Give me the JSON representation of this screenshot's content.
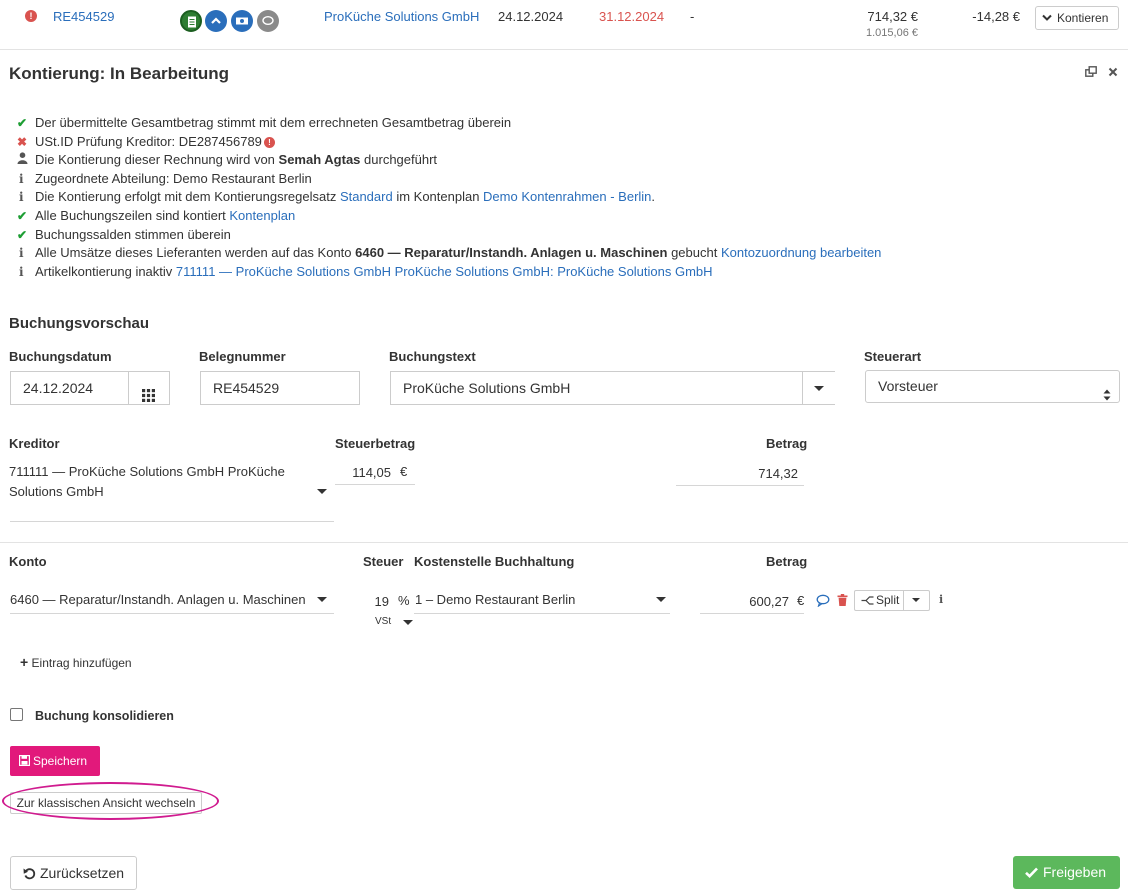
{
  "invoice_row": {
    "invoice_number": "RE454529",
    "vendor": "ProKüche Solutions GmbH",
    "invoice_date": "24.12.2024",
    "due_date": "31.12.2024",
    "dash": "-",
    "amount": "714,32 €",
    "amount_gross": "1.015,06 €",
    "difference": "-14,28 €",
    "action_label": "Kontieren"
  },
  "panel": {
    "title": "Kontierung: In Bearbeitung"
  },
  "checks": [
    {
      "status": "ok",
      "text": "Der übermittelte Gesamtbetrag stimmt mit dem errechneten Gesamtbetrag überein"
    },
    {
      "status": "error",
      "text": "USt.ID Prüfung Kreditor: DE287456789"
    },
    {
      "status": "user",
      "pre": "Die Kontierung dieser Rechnung wird von ",
      "bold": "Semah Agtas",
      "post": " durchgeführt"
    },
    {
      "status": "info",
      "text": "Zugeordnete Abteilung: Demo Restaurant Berlin"
    },
    {
      "status": "info",
      "pre": "Die Kontierung erfolgt mit dem Kontierungsregelsatz ",
      "link1": "Standard",
      "mid": " im Kontenplan ",
      "link2": "Demo Kontenrahmen - Berlin",
      "post": "."
    },
    {
      "status": "ok",
      "pre": "Alle Buchungszeilen sind kontiert ",
      "link": "Kontenplan"
    },
    {
      "status": "ok",
      "text": "Buchungssalden stimmen überein"
    },
    {
      "status": "info",
      "pre": "Alle Umsätze dieses Lieferanten werden auf das Konto ",
      "bold": "6460 — Reparatur/Instandh. Anlagen u. Maschinen",
      "mid": " gebucht ",
      "link": "Kontozuordnung bearbeiten"
    },
    {
      "status": "info",
      "pre": "Artikelkontierung inaktiv ",
      "link": "711111 — ProKüche Solutions GmbH ProKüche Solutions GmbH: ProKüche Solutions GmbH"
    }
  ],
  "preview": {
    "title": "Buchungsvorschau",
    "booking_date_label": "Buchungsdatum",
    "booking_date": "24.12.2024",
    "doc_number_label": "Belegnummer",
    "doc_number": "RE454529",
    "booking_text_label": "Buchungstext",
    "booking_text": "ProKüche Solutions GmbH",
    "tax_type_label": "Steuerart",
    "tax_type": "Vorsteuer",
    "creditor_label": "Kreditor",
    "creditor_line1": "711111 — ProKüche Solutions GmbH ProKüche",
    "creditor_line2": "Solutions GmbH",
    "tax_amount_label": "Steuerbetrag",
    "tax_amount": "114,05",
    "currency": "€",
    "amount_label": "Betrag",
    "amount": "714,32"
  },
  "lines": {
    "account_label": "Konto",
    "tax_label": "Steuer",
    "cost_center_label": "Kostenstelle Buchhaltung",
    "amount_label": "Betrag",
    "account": "6460 — Reparatur/Instandh. Anlagen u. Maschinen",
    "tax_rate": "19",
    "percent": "%",
    "tax_code": "VSt",
    "cost_center": "1 – Demo Restaurant Berlin",
    "amount": "600,27",
    "currency": "€",
    "split_label": "Split",
    "add_entry": "Eintrag hinzufügen"
  },
  "consolidate_label": "Buchung konsolidieren",
  "save_label": "Speichern",
  "classic_view_label": "Zur klassischen Ansicht wechseln",
  "reset_label": "Zurücksetzen",
  "approve_label": "Freigeben",
  "colors": {
    "link": "#2a6ebb",
    "ok": "#1e9e34",
    "error": "#d9534f",
    "save": "#e2197b",
    "approve": "#5cb85c",
    "highlight": "#d01b8f"
  }
}
